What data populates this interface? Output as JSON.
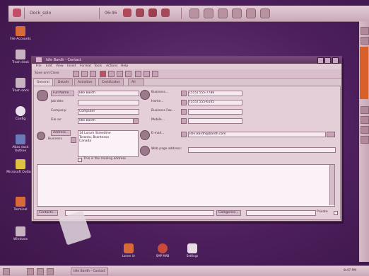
{
  "top_panel": {
    "text": "Dock_solo",
    "time": "06:46"
  },
  "desktop_icons": [
    {
      "label": "File Accounts",
      "icon": "home-folder-icon"
    },
    {
      "label": "Trash desk",
      "icon": "trash-icon"
    },
    {
      "label": "Trash dock",
      "icon": "trash-icon"
    },
    {
      "label": "Config",
      "icon": "config-icon"
    },
    {
      "label": "Atlas dock Outline",
      "icon": "network-icon"
    },
    {
      "label": "Microsoft Outlook",
      "icon": "mail-icon"
    },
    {
      "label": "Terminal",
      "icon": "terminal-icon"
    },
    {
      "label": "Windows",
      "icon": "windows-icon"
    }
  ],
  "window": {
    "title": "Idle Bardh - Contact",
    "menu": [
      "File",
      "Edit",
      "View",
      "Insert",
      "Format",
      "Tools",
      "Actions",
      "Help"
    ],
    "toolbar_label": "Save and Close",
    "tabs": [
      "General",
      "Details",
      "Activities",
      "Certificates",
      "All Fields"
    ],
    "left_fields": [
      {
        "label": "Full Name...",
        "value": "Idle Bardh"
      },
      {
        "label": "Job title:",
        "value": ""
      },
      {
        "label": "Company:",
        "value": "Computer"
      },
      {
        "label": "File as:",
        "value": "Idle Bardh"
      }
    ],
    "address_button": "Address...",
    "address_type": "Business",
    "address_lines": [
      "14 Lorum Streetline",
      "Toronto, Brantessa",
      "Canada"
    ],
    "mailing_checkbox": "This is the mailing address",
    "right_fields": [
      {
        "label": "Business...",
        "value": "(555) 555-7786"
      },
      {
        "label": "Home...",
        "value": "(555) 555-6145"
      },
      {
        "label": "Business Fax...",
        "value": ""
      },
      {
        "label": "Mobile...",
        "value": ""
      }
    ],
    "email_label": "E-mail...",
    "email_value": "Idle.Bardh@bardh.com",
    "web_label": "Web page address:",
    "web_value": "",
    "contacts_button": "Contacts...",
    "categories_button": "Categories...",
    "private_label": "Private"
  },
  "launchers": [
    {
      "label": "Lorem Ur",
      "icon": "app-icon"
    },
    {
      "label": "SMP MAB",
      "icon": "app-icon"
    },
    {
      "label": "Settings",
      "icon": "settings-icon"
    }
  ],
  "bottom_panel": {
    "task": "Idle Bardh - Contact",
    "clock": "8:47 PM"
  }
}
